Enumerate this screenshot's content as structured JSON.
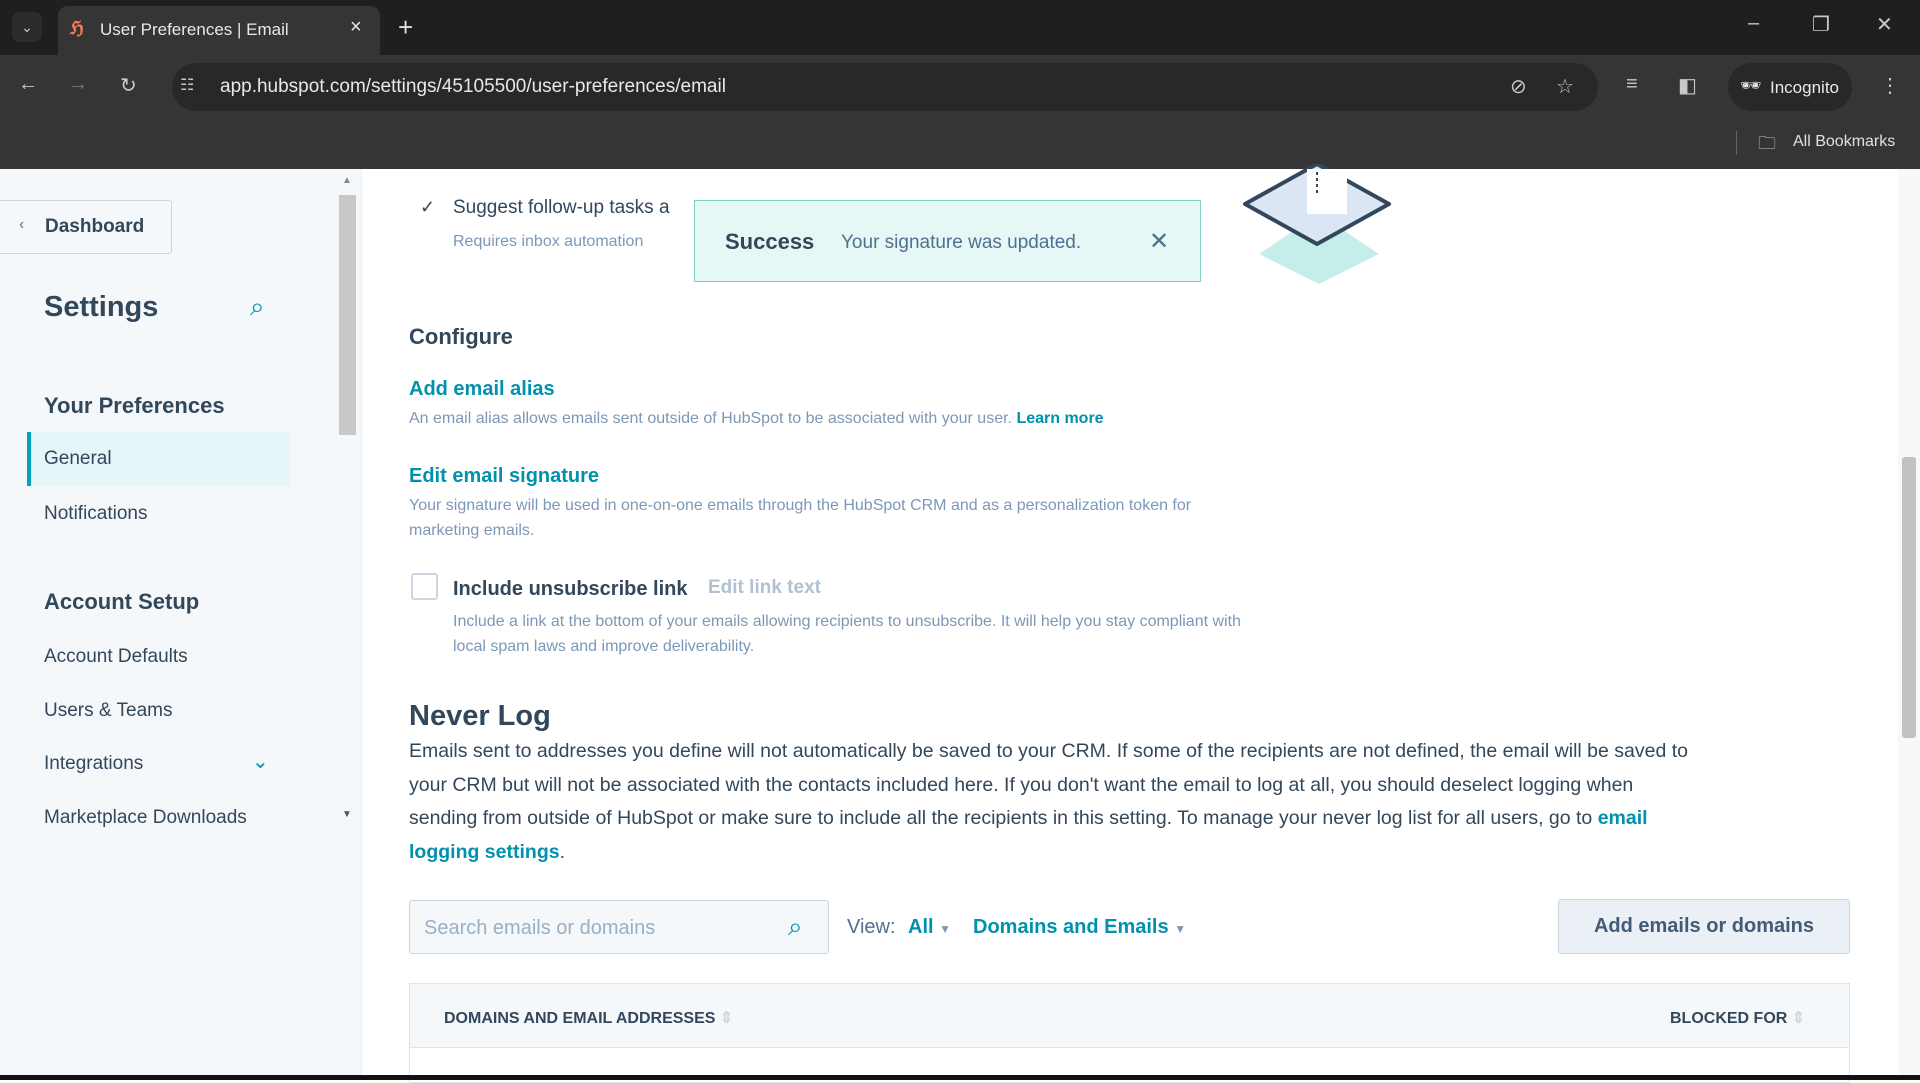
{
  "browser": {
    "tab_title": "User Preferences | Email",
    "url": "app.hubspot.com/settings/45105500/user-preferences/email",
    "profile": "Incognito",
    "bookmarks": "All Bookmarks"
  },
  "sidebar": {
    "back": "Dashboard",
    "title": "Settings",
    "sections": [
      {
        "heading": "Your Preferences",
        "items": [
          {
            "label": "General",
            "active": true
          },
          {
            "label": "Notifications"
          }
        ]
      },
      {
        "heading": "Account Setup",
        "items": [
          {
            "label": "Account Defaults"
          },
          {
            "label": "Users & Teams"
          },
          {
            "label": "Integrations"
          },
          {
            "label": "Marketplace Downloads"
          }
        ]
      }
    ]
  },
  "main": {
    "suggest": {
      "label": "Suggest follow-up tasks a",
      "note": "Requires inbox automation"
    },
    "toast": {
      "title": "Success",
      "message": "Your signature was updated."
    },
    "configure": {
      "heading": "Configure",
      "alias_link": "Add email alias",
      "alias_desc": "An email alias allows emails sent outside of HubSpot to be associated with your user.",
      "learn_more": "Learn more",
      "sig_link": "Edit email signature",
      "sig_desc": "Your signature will be used in one-on-one emails through the HubSpot CRM and as a personalization token for marketing emails.",
      "unsub_label": "Include unsubscribe link",
      "unsub_checked": false,
      "edit_link_text": "Edit link text",
      "unsub_desc": "Include a link at the bottom of your emails allowing recipients to unsubscribe. It will help you stay compliant with local spam laws and improve deliverability."
    },
    "never_log": {
      "heading": "Never Log",
      "text": "Emails sent to addresses you define will not automatically be saved to your CRM. If some of the recipients are not defined, the email will be saved to your CRM but will not be associated with the contacts included here. If you don't want the email to log at all, you should deselect logging when sending from outside of HubSpot or make sure to include all the recipients in this setting. To manage your never log list for all users, go to",
      "link": "email logging settings",
      "search_placeholder": "Search emails or domains",
      "view_label": "View:",
      "view_all": "All",
      "view_type": "Domains and Emails",
      "add_button": "Add emails or domains",
      "columns": [
        "DOMAINS AND EMAIL ADDRESSES",
        "BLOCKED FOR"
      ]
    }
  },
  "colors": {
    "accent": "#0091ae",
    "toast_bg": "#e5f8f6",
    "sidebar_bg": "#f5f8fa"
  }
}
